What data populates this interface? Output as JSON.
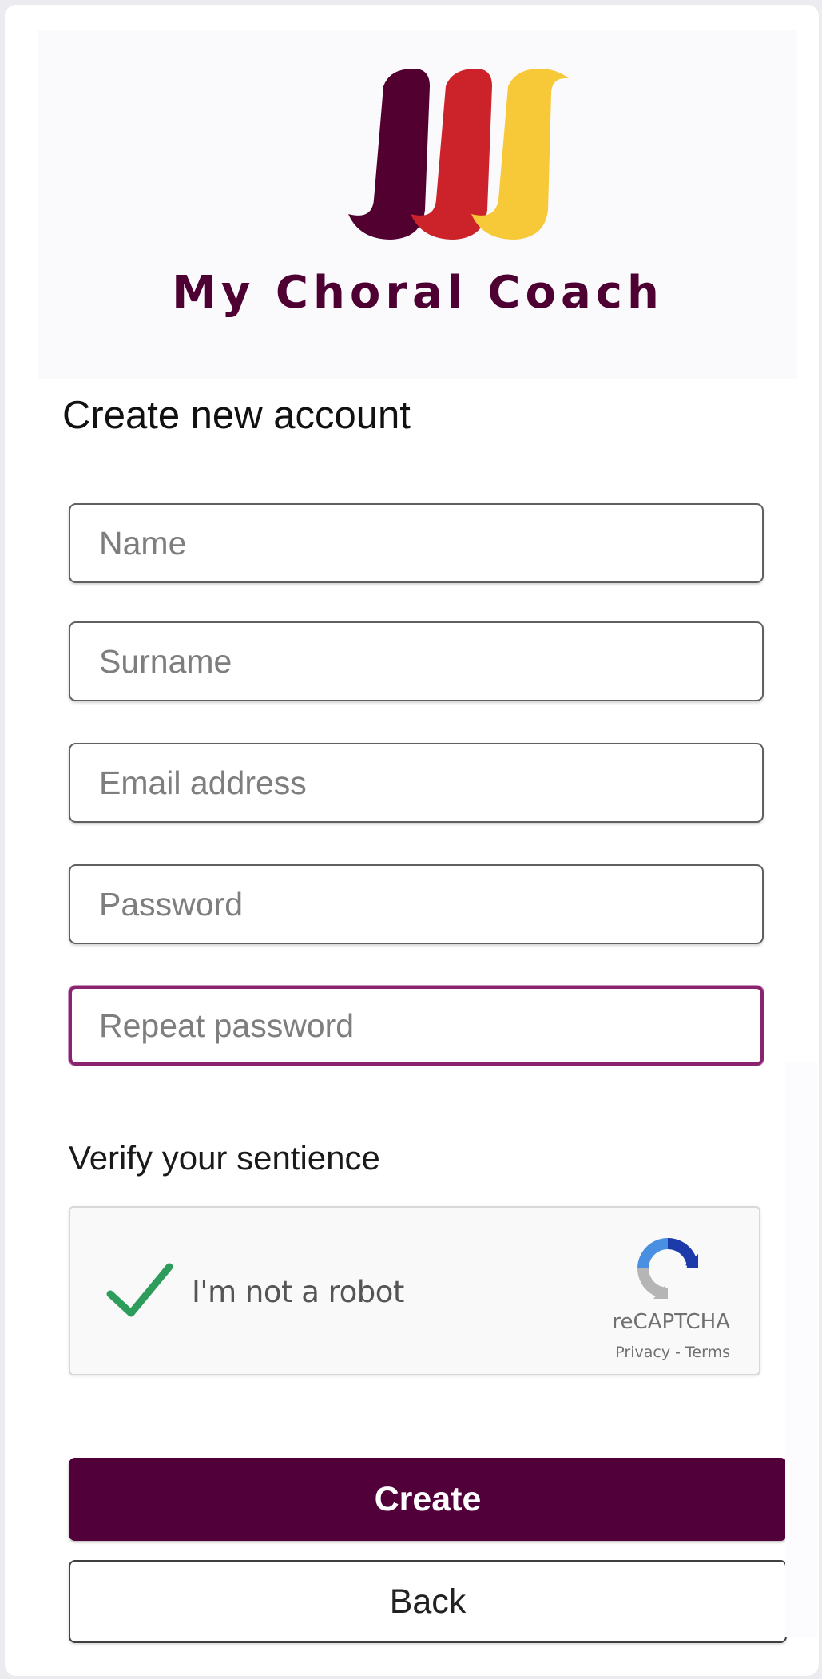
{
  "brand": {
    "name": "My Choral Coach",
    "logo_colors": [
      "#520030",
      "#cc2229",
      "#f7c837"
    ]
  },
  "form": {
    "title": "Create new account",
    "fields": {
      "name": {
        "placeholder": "Name",
        "value": ""
      },
      "surname": {
        "placeholder": "Surname",
        "value": ""
      },
      "email": {
        "placeholder": "Email address",
        "value": ""
      },
      "password": {
        "placeholder": "Password",
        "value": ""
      },
      "repeat_password": {
        "placeholder": "Repeat password",
        "value": "",
        "focused": true
      }
    },
    "verify_label": "Verify your sentience"
  },
  "captcha": {
    "checked": true,
    "label": "I'm not a robot",
    "brand": "reCAPTCHA",
    "privacy_link": "Privacy",
    "separator": "-",
    "terms_link": "Terms"
  },
  "buttons": {
    "create": "Create",
    "back": "Back"
  },
  "colors": {
    "primary": "#52003a",
    "focus_border": "#8b2470",
    "check": "#2e9d5c"
  }
}
